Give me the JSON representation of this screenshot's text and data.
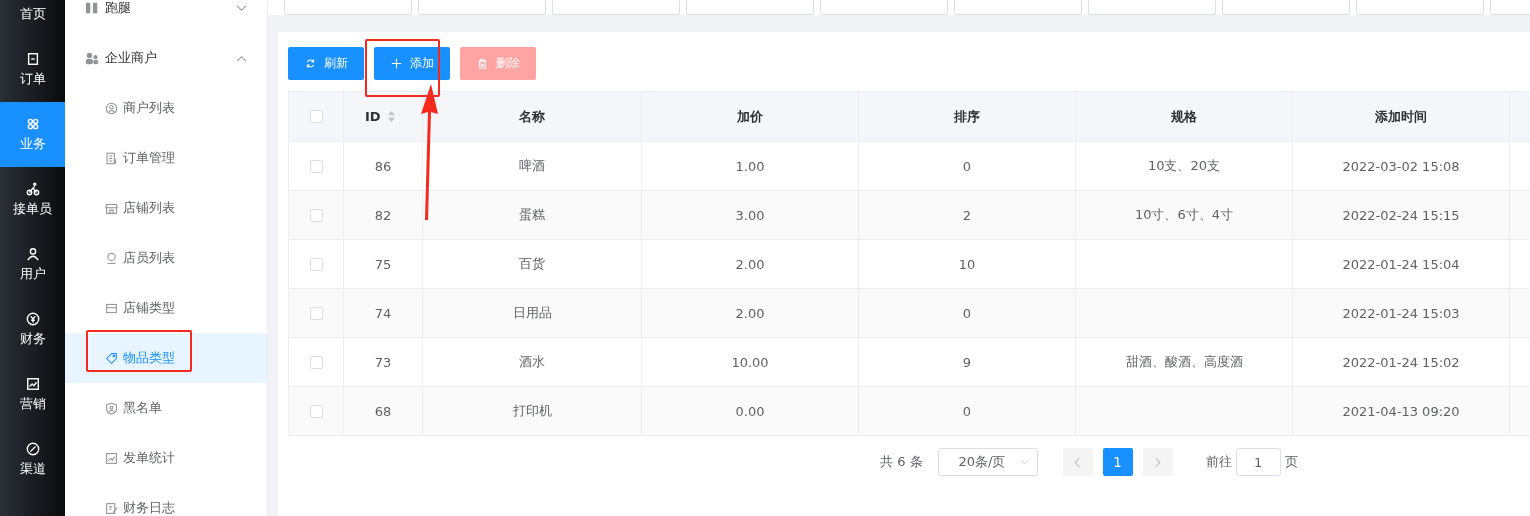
{
  "rail": [
    {
      "label": "首页",
      "selected": false
    },
    {
      "label": "订单",
      "selected": false
    },
    {
      "label": "业务",
      "selected": true
    },
    {
      "label": "接单员",
      "selected": false
    },
    {
      "label": "用户",
      "selected": false
    },
    {
      "label": "财务",
      "selected": false
    },
    {
      "label": "营销",
      "selected": false
    },
    {
      "label": "渠道",
      "selected": false
    }
  ],
  "submenu": {
    "groups": [
      {
        "label": "跑腿",
        "expanded": false
      },
      {
        "label": "企业商户",
        "expanded": true
      }
    ],
    "items": [
      {
        "label": "商户列表",
        "selected": false
      },
      {
        "label": "订单管理",
        "selected": false
      },
      {
        "label": "店铺列表",
        "selected": false
      },
      {
        "label": "店员列表",
        "selected": false
      },
      {
        "label": "店铺类型",
        "selected": false
      },
      {
        "label": "物品类型",
        "selected": true
      },
      {
        "label": "黑名单",
        "selected": false
      },
      {
        "label": "发单统计",
        "selected": false
      },
      {
        "label": "财务日志",
        "selected": false
      }
    ]
  },
  "toolbar": [
    {
      "label": "刷新",
      "kind": "refresh",
      "disabled": false
    },
    {
      "label": "添加",
      "kind": "add",
      "disabled": false
    },
    {
      "label": "删除",
      "kind": "delete",
      "disabled": true
    }
  ],
  "table": {
    "all_checked": false,
    "columns": [
      "ID",
      "名称",
      "加价",
      "排序",
      "规格",
      "添加时间"
    ],
    "rows": [
      {
        "cells": [
          "86",
          "啤酒",
          "1.00",
          "0",
          "10支、20支",
          "2022-03-02 15:08"
        ],
        "checked": false
      },
      {
        "cells": [
          "82",
          "蛋糕",
          "3.00",
          "2",
          "10寸、6寸、4寸",
          "2022-02-24 15:15"
        ],
        "checked": false
      },
      {
        "cells": [
          "75",
          "百货",
          "2.00",
          "10",
          "",
          "2022-01-24 15:04"
        ],
        "checked": false
      },
      {
        "cells": [
          "74",
          "日用品",
          "2.00",
          "0",
          "",
          "2022-01-24 15:03"
        ],
        "checked": false
      },
      {
        "cells": [
          "73",
          "酒水",
          "10.00",
          "9",
          "甜酒、酸酒、高度酒",
          "2022-01-24 15:02"
        ],
        "checked": false
      },
      {
        "cells": [
          "68",
          "打印机",
          "0.00",
          "0",
          "",
          "2021-04-13 09:20"
        ],
        "checked": false
      }
    ]
  },
  "pagination": {
    "total": "共 6 条",
    "page_size": "20条/页",
    "pages": [
      {
        "label": "1",
        "selected": true
      }
    ],
    "goto_label": "前往",
    "goto_value": "1",
    "page_suffix": "页"
  }
}
